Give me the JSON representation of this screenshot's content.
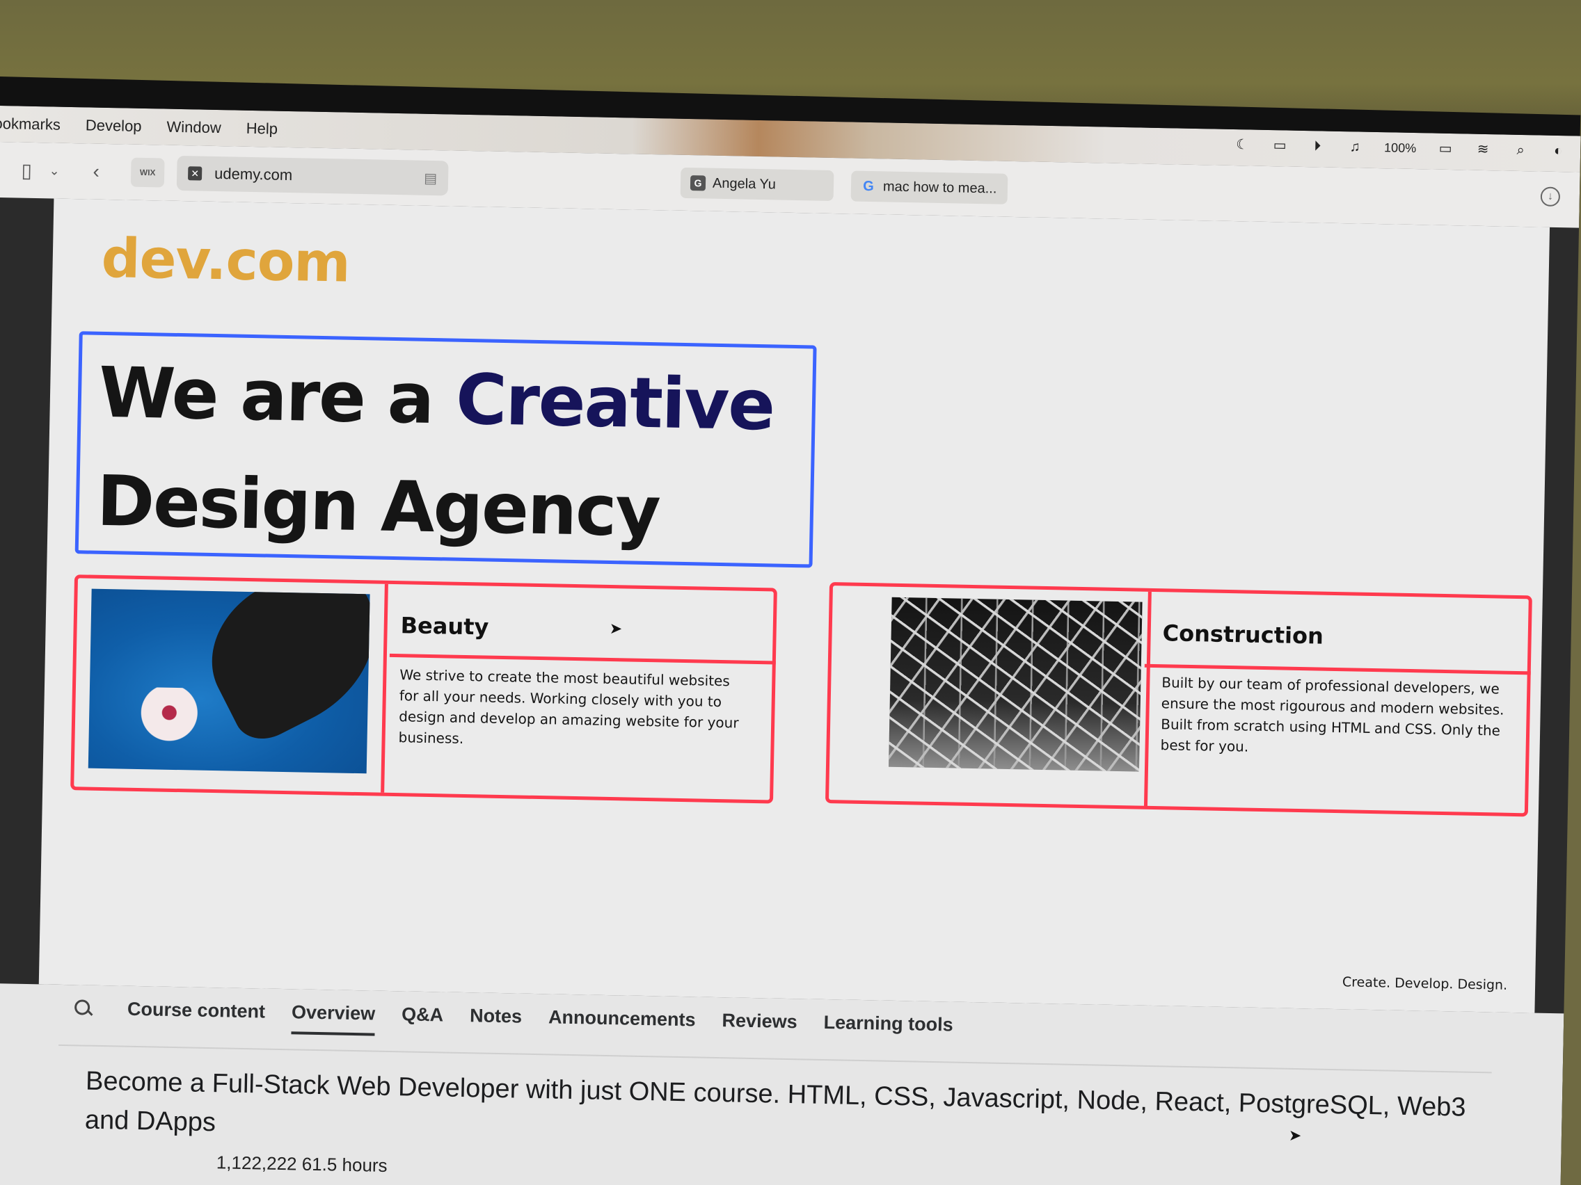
{
  "menubar": {
    "items": [
      "ookmarks",
      "Develop",
      "Window",
      "Help"
    ],
    "battery": "100%"
  },
  "browser": {
    "wix_label": "WIX",
    "url": "udemy.com",
    "tabs": [
      {
        "icon": "G",
        "label": "Angela Yu"
      },
      {
        "icon": "G",
        "label": "mac how to mea..."
      }
    ]
  },
  "page": {
    "logo": "dev.com",
    "hero_part1": "We are a",
    "hero_accent": "Creative",
    "hero_part2": "Design Agency",
    "cards": [
      {
        "title": "Beauty",
        "text": "We strive to create the most beautiful websites for all your needs. Working closely with you to design and develop an amazing website for your business."
      },
      {
        "title": "Construction",
        "text": "Built by our team of professional developers, we ensure the most rigourous and modern websites. Built from scratch using HTML and CSS. Only the best for you."
      }
    ],
    "footer": "Create. Develop. Design."
  },
  "udemy": {
    "tabs": [
      "Course content",
      "Overview",
      "Q&A",
      "Notes",
      "Announcements",
      "Reviews",
      "Learning tools"
    ],
    "active_tab": "Overview",
    "course_title": "Become a Full-Stack Web Developer with just ONE course. HTML, CSS, Javascript, Node, React, PostgreSQL, Web3 and DApps",
    "stats": "1,122,222    61.5 hours"
  },
  "colors": {
    "logo": "#e0a53c",
    "accent": "#16145a",
    "blue_outline": "#3b63ff",
    "red_outline": "#ff3a4e"
  }
}
